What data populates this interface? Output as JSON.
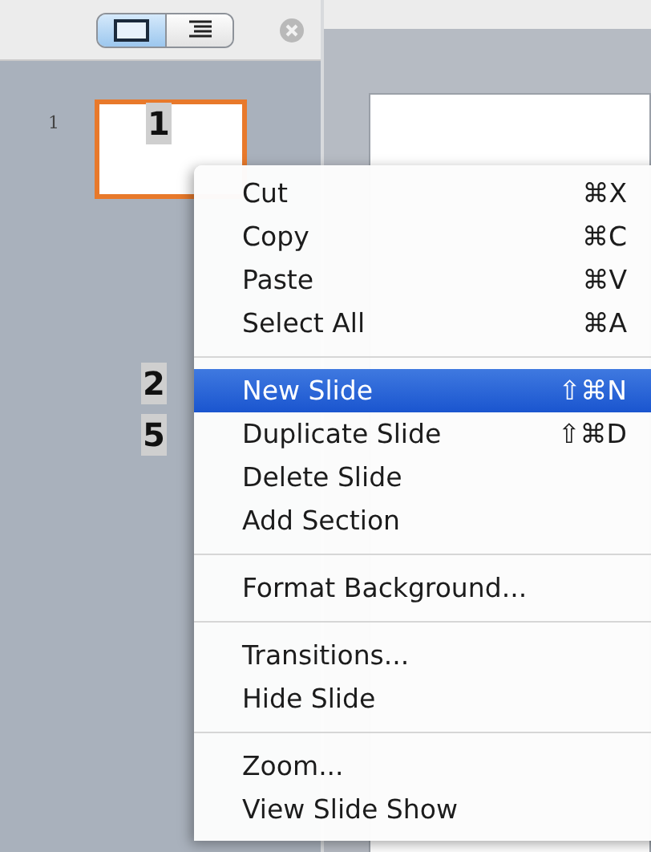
{
  "toolbar": {
    "view_toggle": [
      {
        "kind": "slides",
        "selected": true
      },
      {
        "kind": "outline",
        "selected": false
      }
    ]
  },
  "thumbnails": [
    {
      "number": "1",
      "selected": true
    }
  ],
  "callouts": [
    {
      "label": "1"
    },
    {
      "label": "2"
    },
    {
      "label": "5"
    }
  ],
  "context_menu": {
    "groups": [
      {
        "items": [
          {
            "label": "Cut",
            "shortcut": "⌘X",
            "selected": false
          },
          {
            "label": "Copy",
            "shortcut": "⌘C",
            "selected": false
          },
          {
            "label": "Paste",
            "shortcut": "⌘V",
            "selected": false
          },
          {
            "label": "Select All",
            "shortcut": "⌘A",
            "selected": false
          }
        ]
      },
      {
        "items": [
          {
            "label": "New Slide",
            "shortcut": "⇧⌘N",
            "selected": true
          },
          {
            "label": "Duplicate Slide",
            "shortcut": "⇧⌘D",
            "selected": false
          },
          {
            "label": "Delete Slide",
            "selected": false
          },
          {
            "label": "Add Section",
            "selected": false
          }
        ]
      },
      {
        "items": [
          {
            "label": "Format Background...",
            "selected": false
          }
        ]
      },
      {
        "items": [
          {
            "label": "Transitions...",
            "selected": false
          },
          {
            "label": "Hide Slide",
            "selected": false
          }
        ]
      },
      {
        "items": [
          {
            "label": "Zoom...",
            "selected": false
          },
          {
            "label": "View Slide Show",
            "selected": false
          }
        ]
      }
    ]
  }
}
